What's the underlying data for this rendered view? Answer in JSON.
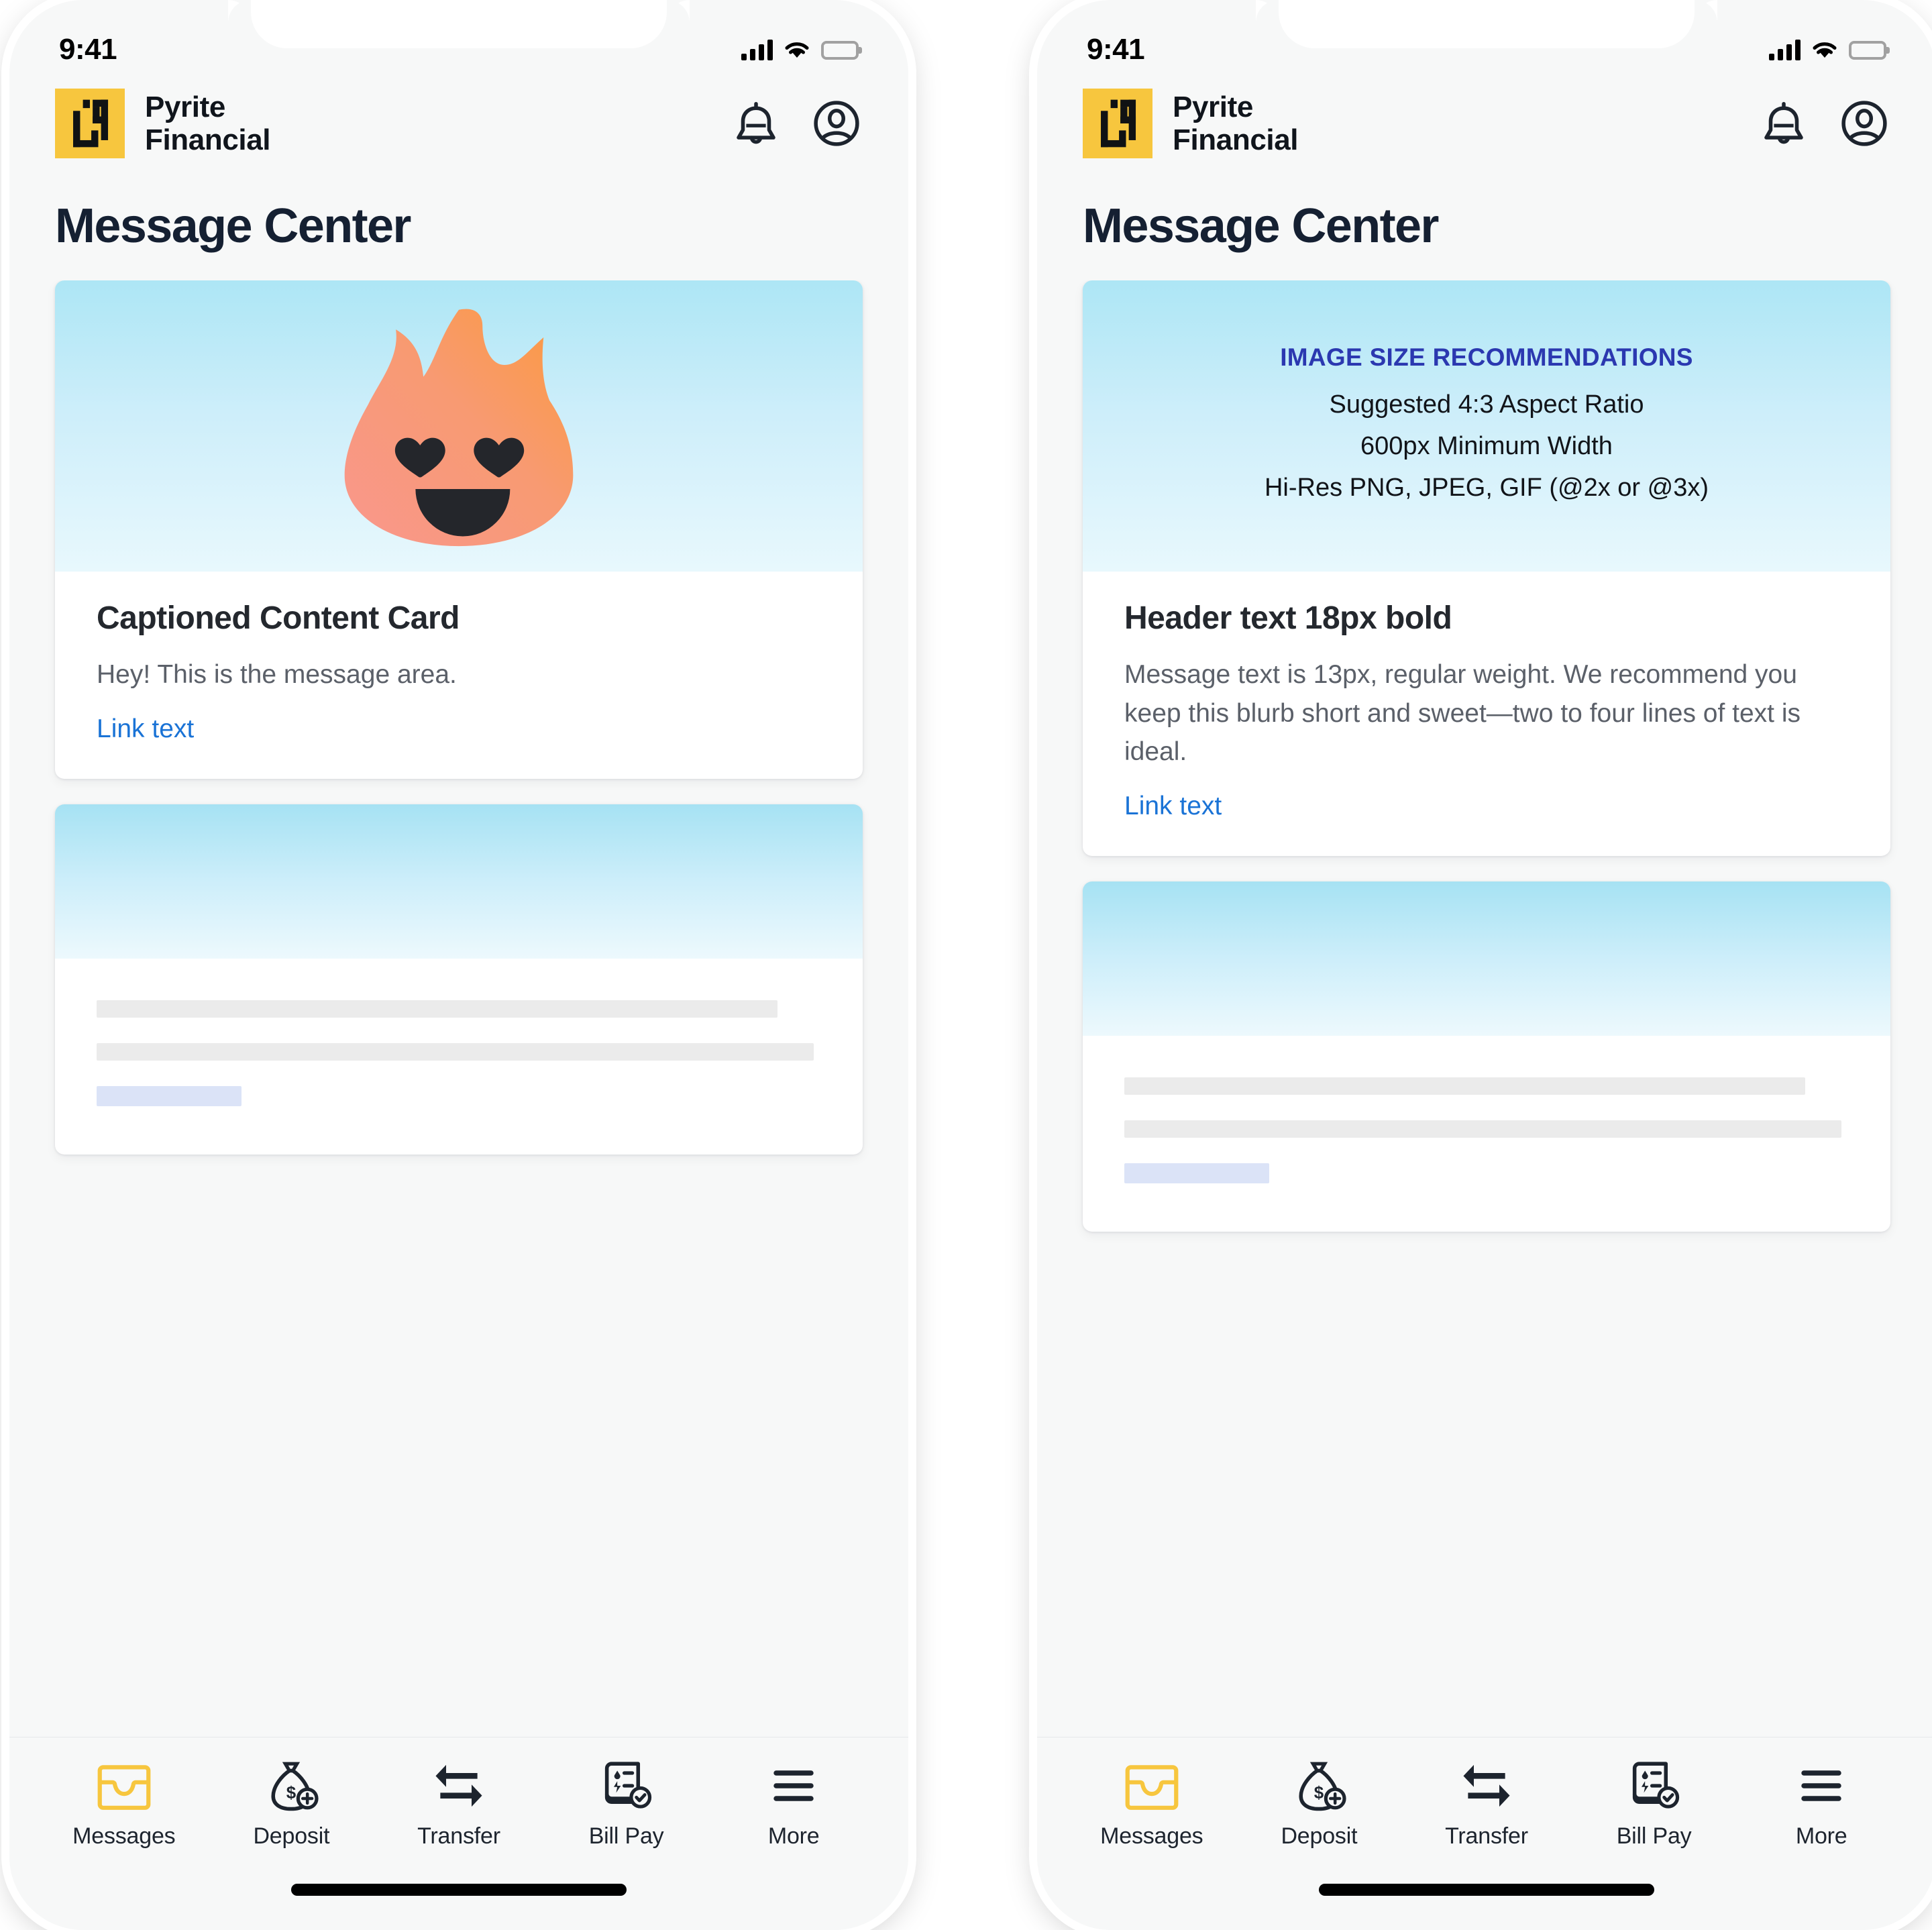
{
  "status_bar": {
    "time": "9:41",
    "signal_icon": "cellular-signal-icon",
    "wifi_icon": "wifi-icon",
    "battery_icon": "battery-full-icon"
  },
  "header": {
    "logo_icon": "pyrite-financial-logo-icon",
    "brand_name": "Pyrite\nFinancial",
    "brand_color": "#F7C63E",
    "notifications_icon": "bell-icon",
    "account_icon": "account-circle-icon"
  },
  "page": {
    "title": "Message Center",
    "title_color": "#152032",
    "background_color": "#f7f8f8"
  },
  "left_phone": {
    "card": {
      "media_icon": "flame-heart-eyes-emoji",
      "media_gradient_top": "#ade6f5",
      "media_gradient_bottom": "#e8f8fd",
      "flame_gradient_start": "#f79b8e",
      "flame_gradient_end": "#f99845",
      "title": "Captioned Content Card",
      "message": "Hey! This is the message area.",
      "link_label": "Link text",
      "link_color": "#1a73d6"
    },
    "skeleton_card": {
      "placeholder_bar_color": "#ebebeb",
      "placeholder_link_color": "#dbe3f7"
    }
  },
  "right_phone": {
    "card": {
      "media_note_title": "IMAGE SIZE RECOMMENDATIONS",
      "media_note_title_color": "#2b38b0",
      "media_note_lines": [
        "Suggested 4:3 Aspect Ratio",
        "600px Minimum Width",
        "Hi-Res PNG, JPEG, GIF (@2x or @3x)"
      ],
      "title": "Header text 18px bold",
      "message": "Message text is 13px, regular weight. We recommend you keep this blurb short and sweet—two to four lines of text is ideal.",
      "link_label": "Link text",
      "link_color": "#1a73d6"
    },
    "skeleton_card": {
      "placeholder_bar_color": "#ebebeb",
      "placeholder_link_color": "#dbe3f7"
    }
  },
  "tabbar": {
    "active_color": "#F7C63E",
    "inactive_color": "#1d242e",
    "items": [
      {
        "label": "Messages",
        "icon": "inbox-icon",
        "active": true
      },
      {
        "label": "Deposit",
        "icon": "money-bag-plus-icon",
        "active": false
      },
      {
        "label": "Transfer",
        "icon": "transfer-arrows-icon",
        "active": false
      },
      {
        "label": "Bill Pay",
        "icon": "bill-check-icon",
        "active": false
      },
      {
        "label": "More",
        "icon": "hamburger-menu-icon",
        "active": false
      }
    ]
  }
}
